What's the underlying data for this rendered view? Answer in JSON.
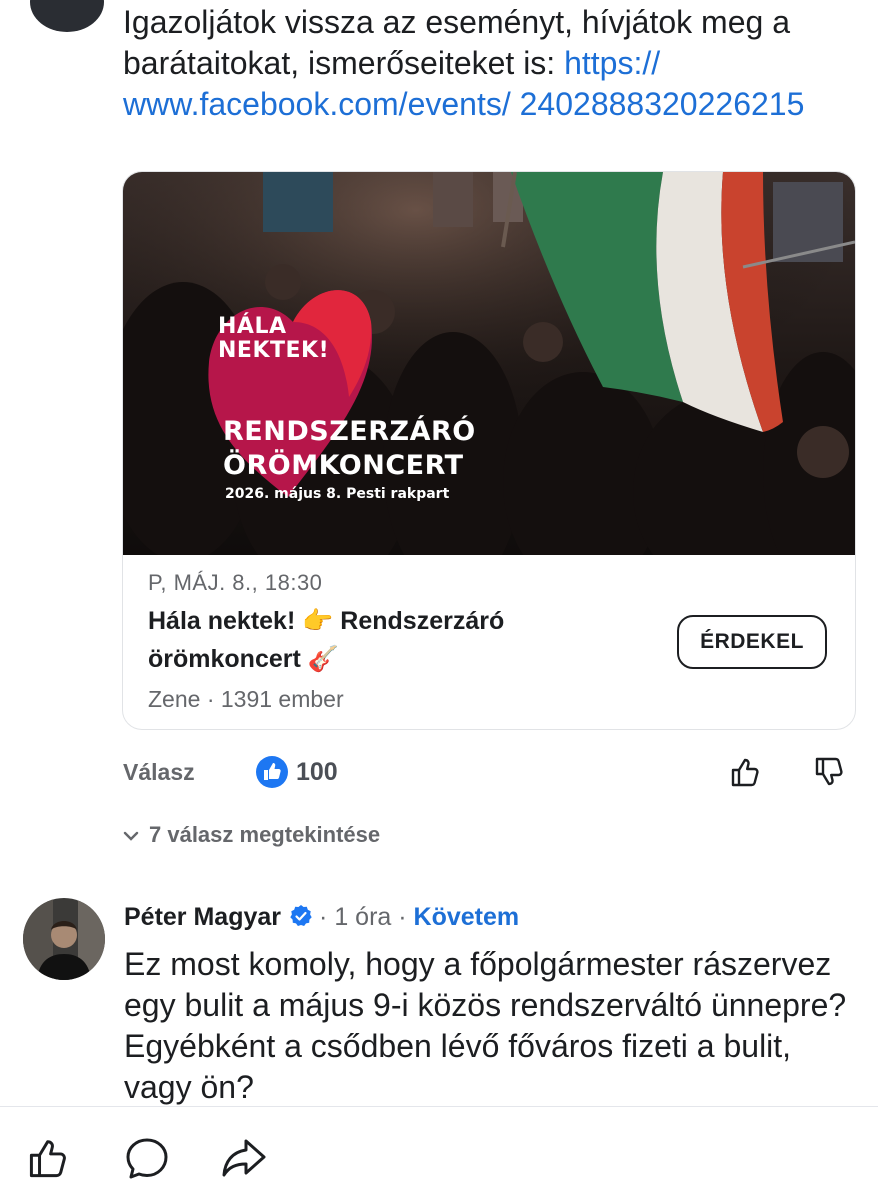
{
  "comment_top": {
    "text": "Igazoljátok vissza az eseményt, hívjátok meg a barátaitokat, ismerőseiteket is:",
    "link": "https:// www.facebook.com/events/ 2402888320226215"
  },
  "event_card": {
    "poster": {
      "heart_line1": "HÁLA",
      "heart_line2": "NEKTEK!",
      "title_line1": "RENDSZERZÁRÓ",
      "title_line2": "ÖRÖMKONCERT",
      "date_place": "2026. május 8. Pesti rakpart"
    },
    "meta": "P, MÁJ. 8., 18:30",
    "title_line1": "Hála nektek! 👉 Rendszerzáró",
    "title_line2": "örömkoncert 🎸",
    "sub": "Zene · 1391 ember",
    "button_label": "ÉRDEKEL"
  },
  "actions": {
    "reply_label": "Válasz",
    "like_count": "100",
    "view_replies": "7 válasz megtekintése"
  },
  "comment_2": {
    "author": "Péter Magyar",
    "dot": "·",
    "time": "1 óra",
    "dot2": "·",
    "follow": "Követem",
    "text": "Ez most komoly, hogy a főpolgármester rászervez egy bulit a május 9-i közös rendszerváltó ünnepre? Egyébként a csődben lévő főváros fizeti a bulit, vagy ön?"
  },
  "colors": {
    "link": "#1d6fd6",
    "like_badge": "#1d77f2",
    "heart": "#b6164a",
    "muted": "#65676b"
  }
}
